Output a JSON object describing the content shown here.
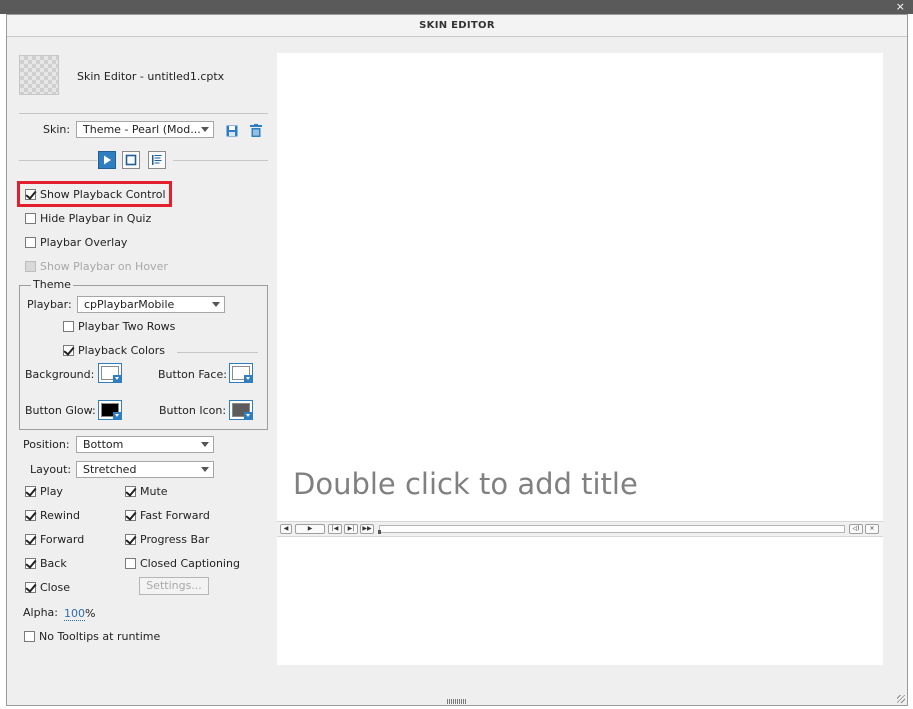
{
  "window": {
    "title": "SKIN EDITOR",
    "close_glyph": "×"
  },
  "project": {
    "title": "Skin Editor - untitled1.cptx"
  },
  "skin": {
    "label": "Skin:",
    "value": "Theme - Pearl (Mod..."
  },
  "tabs": [
    {
      "icon": "playbar-icon",
      "active": true
    },
    {
      "icon": "borders-icon",
      "active": false
    },
    {
      "icon": "toc-icon",
      "active": false
    }
  ],
  "options": {
    "show_playback": {
      "label": "Show Playback Control",
      "checked": true
    },
    "hide_in_quiz": {
      "label": "Hide Playbar in Quiz",
      "checked": false
    },
    "overlay": {
      "label": "Playbar Overlay",
      "checked": false
    },
    "show_on_hover": {
      "label": "Show Playbar on Hover",
      "checked": false,
      "disabled": true
    }
  },
  "theme": {
    "legend": "Theme",
    "playbar_label": "Playbar:",
    "playbar_value": "cpPlaybarMobile",
    "two_rows": {
      "label": "Playbar Two Rows",
      "checked": false
    },
    "colors": {
      "label": "Playback Colors",
      "checked": true
    },
    "background_label": "Background:",
    "button_face_label": "Button Face:",
    "button_glow_label": "Button Glow:",
    "button_icon_label": "Button Icon:",
    "swatch_colors": {
      "background": "#ffffff",
      "button_face": "#ffffff",
      "button_glow": "#000000",
      "button_icon": "#5c5c5c"
    }
  },
  "position": {
    "label": "Position:",
    "value": "Bottom"
  },
  "layout": {
    "label": "Layout:",
    "value": "Stretched"
  },
  "controls": {
    "play": {
      "label": "Play",
      "checked": true
    },
    "mute": {
      "label": "Mute",
      "checked": true
    },
    "rewind": {
      "label": "Rewind",
      "checked": true
    },
    "fast_forward": {
      "label": "Fast Forward",
      "checked": true
    },
    "forward": {
      "label": "Forward",
      "checked": true
    },
    "progress_bar": {
      "label": "Progress Bar",
      "checked": true
    },
    "back": {
      "label": "Back",
      "checked": true
    },
    "closed_captioning": {
      "label": "Closed Captioning",
      "checked": false
    },
    "close": {
      "label": "Close",
      "checked": true
    },
    "settings_button": "Settings..."
  },
  "alpha": {
    "label": "Alpha:",
    "value": "100",
    "unit": "%"
  },
  "no_tooltips": {
    "label": "No Tooltips at runtime",
    "checked": false
  },
  "stage": {
    "placeholder": "Double click to add title"
  },
  "colors": {
    "accent": "#2f7ec1",
    "highlight": "#e31e2d"
  }
}
